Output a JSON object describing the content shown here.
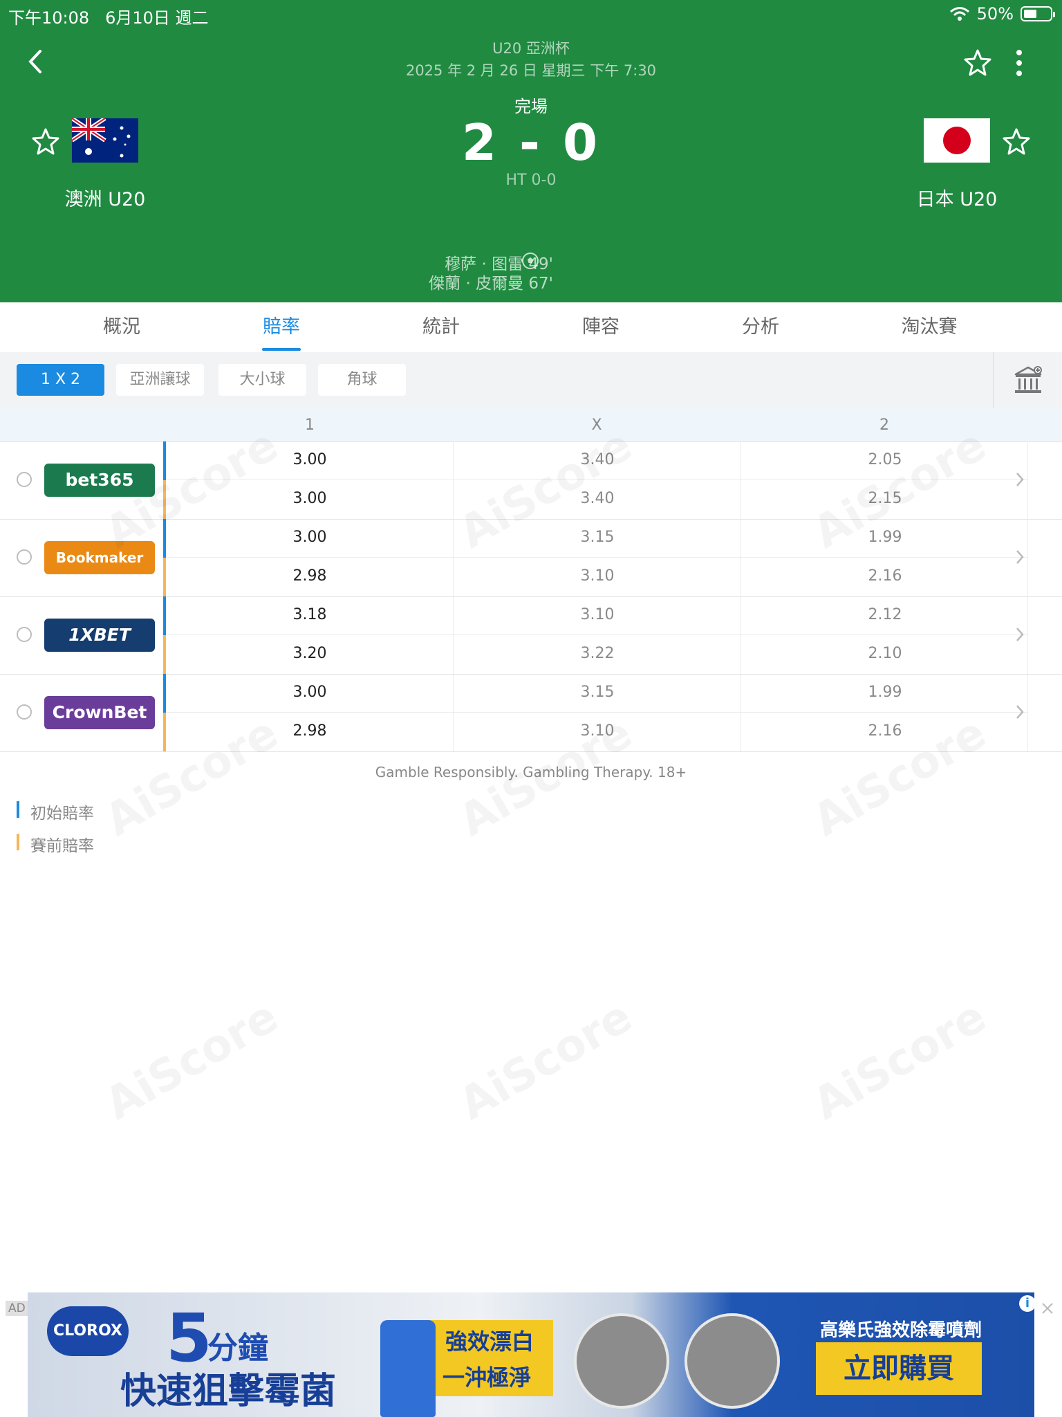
{
  "status_bar": {
    "time": "下午10:08",
    "date": "6月10日 週二",
    "battery": "50%",
    "battery_level": 0.5
  },
  "match": {
    "competition": "U20 亞洲杯",
    "datetime": "2025 年 2 月 26 日  星期三  下午 7:30",
    "status": "完場",
    "score": "2 - 0",
    "halftime": "HT 0-0",
    "home": {
      "name": "澳洲 U20",
      "flag": "australia-flag"
    },
    "away": {
      "name": "日本 U20",
      "flag": "japan-flag"
    },
    "scorers": [
      "穆萨 · 图雷 49'",
      "傑蘭 · 皮爾曼 67'"
    ]
  },
  "tabs": [
    "概況",
    "賠率",
    "統計",
    "陣容",
    "分析",
    "淘汰賽"
  ],
  "active_tab": "賠率",
  "markets": [
    "1 X 2",
    "亞洲讓球",
    "大小球",
    "角球"
  ],
  "active_market": "1 X 2",
  "odds_table": {
    "headers": [
      "1",
      "X",
      "2"
    ],
    "bookmakers": [
      {
        "name": "bet365",
        "initial": [
          "3.00",
          "3.40",
          "2.05"
        ],
        "prematch": [
          "3.00",
          "3.40",
          "2.15"
        ]
      },
      {
        "name": "Bookmaker",
        "initial": [
          "3.00",
          "3.15",
          "1.99"
        ],
        "prematch": [
          "2.98",
          "3.10",
          "2.16"
        ]
      },
      {
        "name": "1XBET",
        "initial": [
          "3.18",
          "3.10",
          "2.12"
        ],
        "prematch": [
          "3.20",
          "3.22",
          "2.10"
        ]
      },
      {
        "name": "CrownBet",
        "initial": [
          "3.00",
          "3.15",
          "1.99"
        ],
        "prematch": [
          "2.98",
          "3.10",
          "2.16"
        ]
      }
    ]
  },
  "disclaimer": "Gamble Responsibly. Gambling Therapy. 18+",
  "legend": {
    "initial": "初始賠率",
    "prematch": "賽前賠率"
  },
  "watermark": "AiScore",
  "colors": {
    "header_green": "#208a41",
    "accent_blue": "#1a8be0",
    "prematch_orange": "#f5b55a"
  },
  "ad": {
    "tag": "AD",
    "brand_logo": "CLOROX",
    "five": "5",
    "minutes": "分鐘",
    "headline": "快速狙擊霉菌",
    "bleach": "強效漂白",
    "clean": "一沖極淨",
    "brand_line": "高樂氏強效除霉噴劑",
    "cta": "立即購買",
    "info": "i",
    "close": "✕"
  }
}
